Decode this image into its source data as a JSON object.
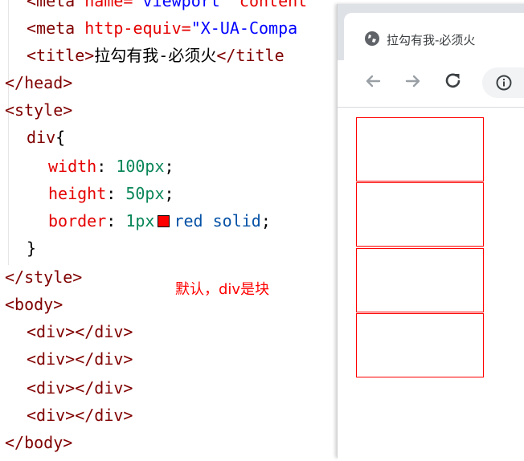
{
  "code": {
    "line0": {
      "tag_open": "<meta",
      "attr": " name=",
      "val": "\"viewport\"",
      "rest": " content"
    },
    "line1": {
      "tag_open": "<meta",
      "attr": " http-equiv=",
      "val": "\"X-UA-Compa"
    },
    "line2": {
      "open": "<title>",
      "text": "拉勾有我-必须火",
      "close": "</title"
    },
    "line3": {
      "text": "</head>"
    },
    "line4": {
      "text": "<style>"
    },
    "line5": {
      "selector": "div",
      "brace": "{"
    },
    "line6": {
      "prop": "width",
      "colon": ": ",
      "value": "100px",
      "semi": ";"
    },
    "line7": {
      "prop": "height",
      "colon": ": ",
      "value": "50px",
      "semi": ";"
    },
    "line8": {
      "prop": "border",
      "colon": ": ",
      "value": "1px",
      "color_word": "red",
      "style_word": "solid",
      "semi": ";"
    },
    "line9": {
      "text": "}"
    },
    "line10": {
      "text": "</style>"
    },
    "line11": {
      "text": "<body>"
    },
    "line12": {
      "open": "<div>",
      "close": "</div>"
    },
    "line13": {
      "open": "<div>",
      "close": "</div>"
    },
    "line14": {
      "open": "<div>",
      "close": "</div>"
    },
    "line15": {
      "open": "<div>",
      "close": "</div>"
    },
    "line16": {
      "text": "</body>"
    }
  },
  "annotation": "默认，div是块",
  "browser": {
    "tab_title": "拉勾有我-必须火",
    "tab_icon": "globe-icon",
    "nav_icons": [
      "back-arrow-icon",
      "forward-arrow-icon",
      "reload-icon",
      "info-icon"
    ],
    "box_count": 4,
    "box_border_color": "#ff0000"
  },
  "colors": {
    "tag": "#800000",
    "attribute": "#e50000",
    "string": "#0000ff",
    "number": "#098658",
    "keyword_value": "#0451a5",
    "annotation": "#ff0000"
  }
}
